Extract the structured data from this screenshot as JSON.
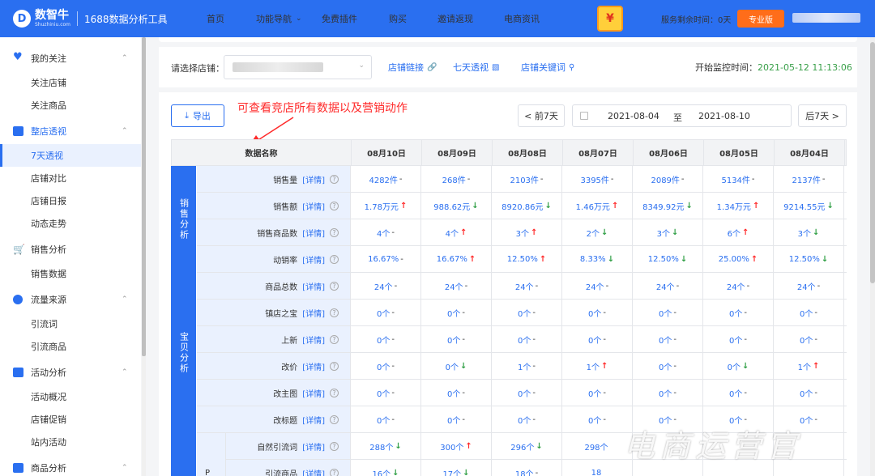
{
  "app": {
    "logo_mark": "D",
    "name": "数智牛",
    "sub": "Shuzhiniu.com",
    "tool": "1688数据分析工具"
  },
  "nav": [
    "首页",
    "功能导航",
    "免费插件",
    "购买",
    "邀请返现",
    "电商资讯"
  ],
  "nav_dropdown_index": 1,
  "gift_text": "¥",
  "service_left": "服务剩余时间：0天",
  "plan_badge": "专业版",
  "sidebar": {
    "groups": [
      {
        "label": "我的关注",
        "icon": "heart-icon",
        "items": [
          "关注店铺",
          "关注商品"
        ]
      },
      {
        "label": "整店透视",
        "icon": "shop-icon",
        "items": [
          "7天透视",
          "店铺对比",
          "店铺日报",
          "动态走势"
        ],
        "active_item": "7天透视"
      },
      {
        "label": "销售分析",
        "icon": "cart-icon",
        "items": [
          "销售数据"
        ]
      },
      {
        "label": "流量来源",
        "icon": "traffic-icon",
        "items": [
          "引流词",
          "引流商品"
        ]
      },
      {
        "label": "活动分析",
        "icon": "activity-icon",
        "items": [
          "活动概况",
          "店铺促销",
          "站内活动"
        ]
      },
      {
        "label": "商品分析",
        "icon": "goods-icon",
        "items": []
      }
    ]
  },
  "shopbar": {
    "label": "请选择店铺：",
    "links": [
      {
        "label": "店铺链接",
        "icon": "link-icon"
      },
      {
        "label": "七天透视",
        "icon": "chart-icon"
      },
      {
        "label": "店铺关键词",
        "icon": "search-icon"
      }
    ],
    "start_label": "开始监控时间：",
    "start_value": "2021-05-12 11:13:06"
  },
  "toolbar": {
    "export": "导出",
    "note": "可查看竞店所有数据以及营销动作",
    "prev": "< 前7天",
    "date_from": "2021-08-04",
    "date_to_sep": "至",
    "date_to": "2021-08-10",
    "next": "后7天 >"
  },
  "table": {
    "header_name": "数据名称",
    "dates": [
      "08月10日",
      "08月09日",
      "08月08日",
      "08月07日",
      "08月06日",
      "08月05日",
      "08月04日"
    ],
    "detail_label": "[详情]",
    "categories": [
      {
        "label": "销售分析",
        "rows": 4
      },
      {
        "label": "宝贝分析",
        "rows": 6
      },
      {
        "label": "",
        "rows": 2
      }
    ],
    "sub_category": "P",
    "rows": [
      {
        "name": "销售量",
        "cells": [
          [
            "4282件",
            "-"
          ],
          [
            "268件",
            "-"
          ],
          [
            "2103件",
            "-"
          ],
          [
            "3395件",
            "-"
          ],
          [
            "2089件",
            "-"
          ],
          [
            "5134件",
            "-"
          ],
          [
            "2137件",
            "-"
          ]
        ]
      },
      {
        "name": "销售额",
        "cells": [
          [
            "1.78万元",
            "↑"
          ],
          [
            "988.62元",
            "↓"
          ],
          [
            "8920.86元",
            "↓"
          ],
          [
            "1.46万元",
            "↑"
          ],
          [
            "8349.92元",
            "↓"
          ],
          [
            "1.34万元",
            "↑"
          ],
          [
            "9214.55元",
            "↓"
          ]
        ]
      },
      {
        "name": "销售商品数",
        "cells": [
          [
            "4个",
            "-"
          ],
          [
            "4个",
            "↑"
          ],
          [
            "3个",
            "↑"
          ],
          [
            "2个",
            "↓"
          ],
          [
            "3个",
            "↓"
          ],
          [
            "6个",
            "↑"
          ],
          [
            "3个",
            "↓"
          ]
        ]
      },
      {
        "name": "动销率",
        "cells": [
          [
            "16.67%",
            "-"
          ],
          [
            "16.67%",
            "↑"
          ],
          [
            "12.50%",
            "↑"
          ],
          [
            "8.33%",
            "↓"
          ],
          [
            "12.50%",
            "↓"
          ],
          [
            "25.00%",
            "↑"
          ],
          [
            "12.50%",
            "↓"
          ]
        ]
      },
      {
        "name": "商品总数",
        "cells": [
          [
            "24个",
            "-"
          ],
          [
            "24个",
            "-"
          ],
          [
            "24个",
            "-"
          ],
          [
            "24个",
            "-"
          ],
          [
            "24个",
            "-"
          ],
          [
            "24个",
            "-"
          ],
          [
            "24个",
            "-"
          ]
        ]
      },
      {
        "name": "镇店之宝",
        "cells": [
          [
            "0个",
            "-"
          ],
          [
            "0个",
            "-"
          ],
          [
            "0个",
            "-"
          ],
          [
            "0个",
            "-"
          ],
          [
            "0个",
            "-"
          ],
          [
            "0个",
            "-"
          ],
          [
            "0个",
            "-"
          ]
        ]
      },
      {
        "name": "上新",
        "cells": [
          [
            "0个",
            "-"
          ],
          [
            "0个",
            "-"
          ],
          [
            "0个",
            "-"
          ],
          [
            "0个",
            "-"
          ],
          [
            "0个",
            "-"
          ],
          [
            "0个",
            "-"
          ],
          [
            "0个",
            "-"
          ]
        ]
      },
      {
        "name": "改价",
        "cells": [
          [
            "0个",
            "-"
          ],
          [
            "0个",
            "↓"
          ],
          [
            "1个",
            "-"
          ],
          [
            "1个",
            "↑"
          ],
          [
            "0个",
            "-"
          ],
          [
            "0个",
            "↓"
          ],
          [
            "1个",
            "↑"
          ]
        ]
      },
      {
        "name": "改主图",
        "cells": [
          [
            "0个",
            "-"
          ],
          [
            "0个",
            "-"
          ],
          [
            "0个",
            "-"
          ],
          [
            "0个",
            "-"
          ],
          [
            "0个",
            "-"
          ],
          [
            "0个",
            "-"
          ],
          [
            "0个",
            "-"
          ]
        ]
      },
      {
        "name": "改标题",
        "cells": [
          [
            "0个",
            "-"
          ],
          [
            "0个",
            "-"
          ],
          [
            "0个",
            "-"
          ],
          [
            "0个",
            "-"
          ],
          [
            "0个",
            "-"
          ],
          [
            "0个",
            "-"
          ],
          [
            "0个",
            "-"
          ]
        ]
      },
      {
        "name": "自然引流词",
        "cells": [
          [
            "288个",
            "↓"
          ],
          [
            "300个",
            "↑"
          ],
          [
            "296个",
            "↓"
          ],
          [
            "298个",
            ""
          ],
          [
            "",
            ""
          ],
          [
            "",
            ""
          ],
          [
            "",
            ""
          ]
        ]
      },
      {
        "name": "引流商品",
        "cells": [
          [
            "16个",
            "↓"
          ],
          [
            "17个",
            "↓"
          ],
          [
            "18个",
            "-"
          ],
          [
            "18",
            ""
          ],
          [
            "",
            ""
          ],
          [
            "",
            ""
          ],
          [
            "",
            ""
          ]
        ]
      }
    ]
  },
  "watermark": "电商运营官",
  "colors": {
    "brand": "#2a6ff0",
    "up": "#ff2a2a",
    "down": "#2f9e44",
    "badge": "#ff6d1a"
  }
}
